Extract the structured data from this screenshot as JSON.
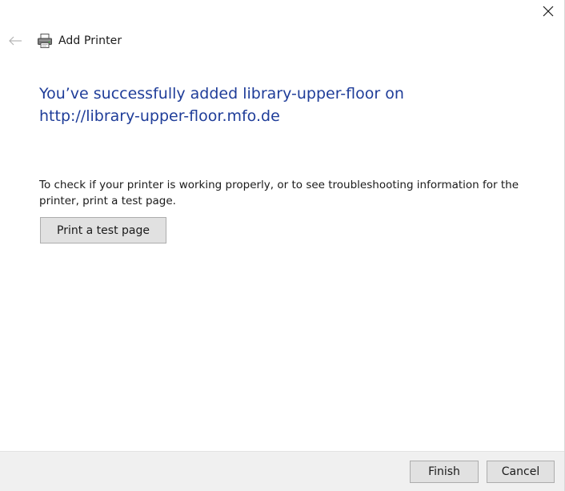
{
  "window": {
    "title": "Add Printer",
    "icons": {
      "close": "close-icon",
      "back": "back-arrow-icon",
      "app": "printer-icon"
    }
  },
  "content": {
    "headline": "You’ve successfully added library-upper-floor on http://library-upper-floor.mfo.de",
    "description": "To check if your printer is working properly, or to see troubleshooting information for the printer, print a test page.",
    "test_button_label": "Print a test page"
  },
  "footer": {
    "finish_label": "Finish",
    "cancel_label": "Cancel"
  },
  "colors": {
    "headline": "#1f3d99",
    "footer_bg": "#f0f0f0",
    "button_bg": "#e1e1e1"
  }
}
